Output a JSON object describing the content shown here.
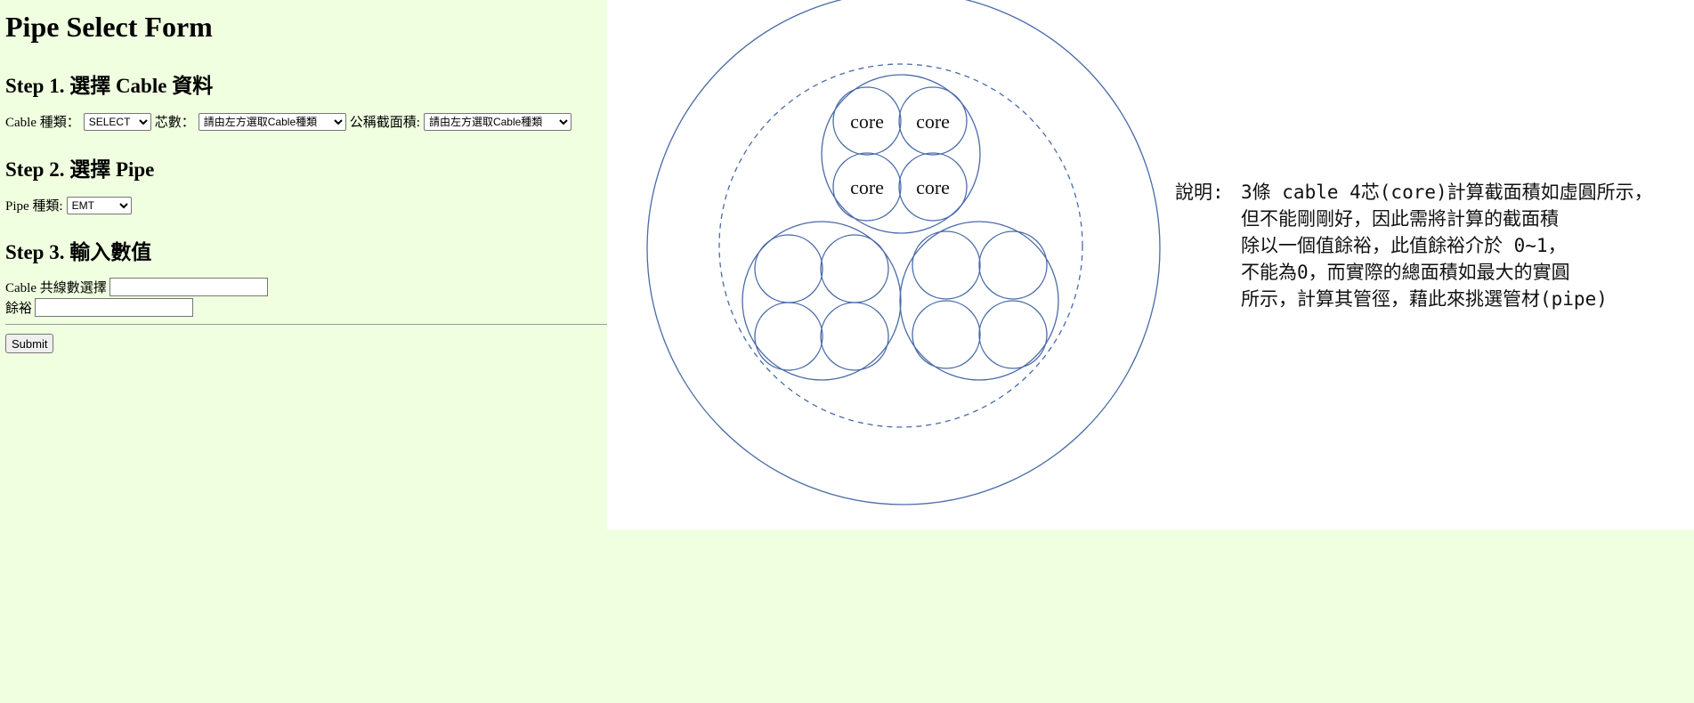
{
  "page": {
    "title": "Pipe Select Form",
    "step1_heading": "Step 1. 選擇 Cable 資料",
    "step2_heading": "Step 2. 選擇 Pipe",
    "step3_heading": "Step 3. 輸入數值"
  },
  "step1": {
    "cable_type_label": "Cable 種類：",
    "cable_type_value": "SELECT",
    "core_count_label": "芯數：",
    "core_count_value": "請由左方選取Cable種類",
    "nominal_area_label": "公稱截面積:",
    "nominal_area_value": "請由左方選取Cable種類"
  },
  "step2": {
    "pipe_type_label": "Pipe 種類:",
    "pipe_type_value": "EMT"
  },
  "step3": {
    "cable_count_label": "Cable 共線數選擇",
    "cable_count_value": "",
    "margin_label": "餘裕",
    "margin_value": ""
  },
  "form": {
    "submit_label": "Submit"
  },
  "diagram": {
    "core_label": "core",
    "line_color": "#4a6ba8"
  },
  "description": {
    "label": "說明:",
    "lines": [
      "3條 cable 4芯(core)計算截面積如虛圓所示，",
      "但不能剛剛好，因此需將計算的截面積",
      "除以一個值餘裕，此值餘裕介於 0~1，",
      "不能為0，而實際的總面積如最大的實圓",
      "所示，計算其管徑，藉此來挑選管材(pipe)"
    ]
  }
}
